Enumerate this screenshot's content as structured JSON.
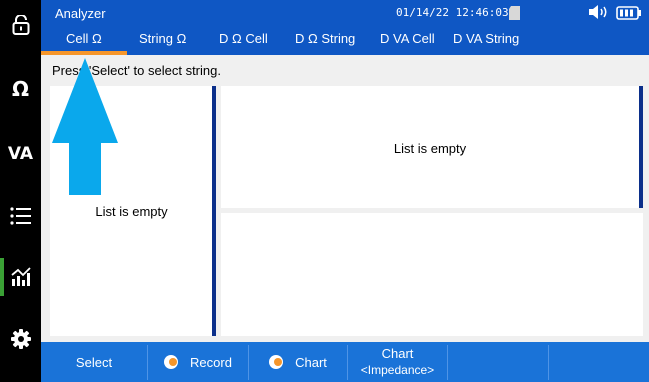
{
  "header": {
    "title": "Analyzer",
    "datetime": "01/14/22 12:46:03",
    "icons": [
      "sd-card-icon",
      "speaker-icon",
      "battery-icon"
    ]
  },
  "tabs": [
    {
      "label": "Cell Ω",
      "active": true
    },
    {
      "label": "String Ω"
    },
    {
      "label": "D Ω Cell"
    },
    {
      "label": "D Ω String"
    },
    {
      "label": "D VA Cell"
    },
    {
      "label": "D VA String"
    }
  ],
  "sidebar": {
    "items": [
      {
        "name": "lock-icon"
      },
      {
        "label": "Ω"
      },
      {
        "label": "VA"
      },
      {
        "name": "list-icon"
      },
      {
        "name": "chart-icon",
        "active": true
      },
      {
        "name": "settings-icon"
      }
    ]
  },
  "main": {
    "prompt": "Press 'Select' to select string.",
    "left_panel_text": "List is empty",
    "right_panel_text": "List is empty"
  },
  "bottombar": {
    "select_label": "Select",
    "record_label": "Record",
    "chart_label": "Chart",
    "chart_mode_line1": "Chart",
    "chart_mode_line2": "<Impedance>"
  },
  "colors": {
    "header_blue": "#0f57c4",
    "bottombar_blue": "#1a73d8",
    "accent_orange": "#f6962a",
    "arrow_cyan": "#0aa8ec",
    "divider_navy": "#0b2f8a",
    "sidebar_active_green": "#3aa035"
  }
}
